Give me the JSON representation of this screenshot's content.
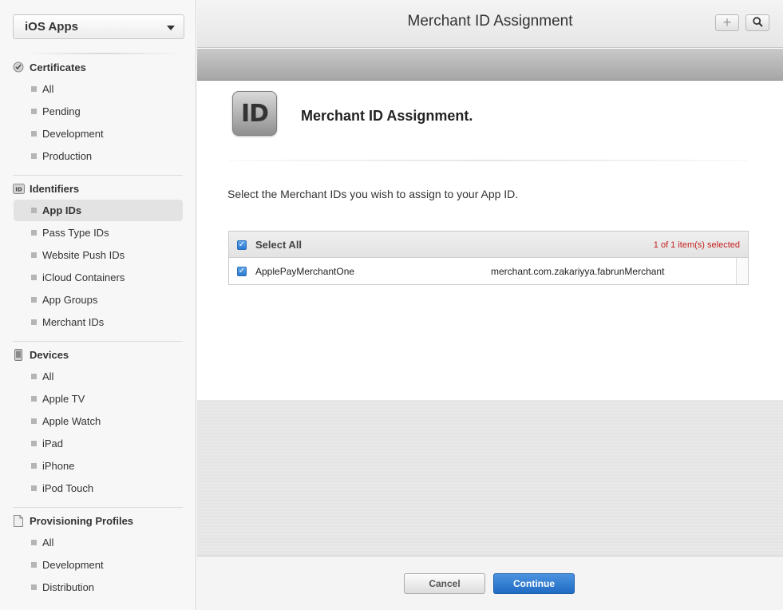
{
  "app_selector": {
    "value": "iOS Apps"
  },
  "sidebar": {
    "certificates": {
      "title": "Certificates",
      "items": [
        "All",
        "Pending",
        "Development",
        "Production"
      ]
    },
    "identifiers": {
      "title": "Identifiers",
      "items": [
        "App IDs",
        "Pass Type IDs",
        "Website Push IDs",
        "iCloud Containers",
        "App Groups",
        "Merchant IDs"
      ],
      "active": "App IDs"
    },
    "devices": {
      "title": "Devices",
      "items": [
        "All",
        "Apple TV",
        "Apple Watch",
        "iPad",
        "iPhone",
        "iPod Touch"
      ]
    },
    "profiles": {
      "title": "Provisioning Profiles",
      "items": [
        "All",
        "Development",
        "Distribution"
      ]
    }
  },
  "topbar": {
    "title": "Merchant ID Assignment",
    "add_icon": "+",
    "search_icon": "search-icon"
  },
  "main": {
    "icon_text": "ID",
    "heading": "Merchant ID Assignment.",
    "instructions": "Select the Merchant IDs you wish to assign to your App ID.",
    "table": {
      "select_all_label": "Select All",
      "selected_count": "1 of 1 item(s) selected",
      "rows": [
        {
          "name": "ApplePayMerchantOne",
          "identifier": "merchant.com.zakariyya.fabrunMerchant",
          "checked": true
        }
      ]
    }
  },
  "footer": {
    "cancel_label": "Cancel",
    "continue_label": "Continue"
  },
  "colors": {
    "accent": "#2b7bd0",
    "count_text": "#c41e1e"
  }
}
